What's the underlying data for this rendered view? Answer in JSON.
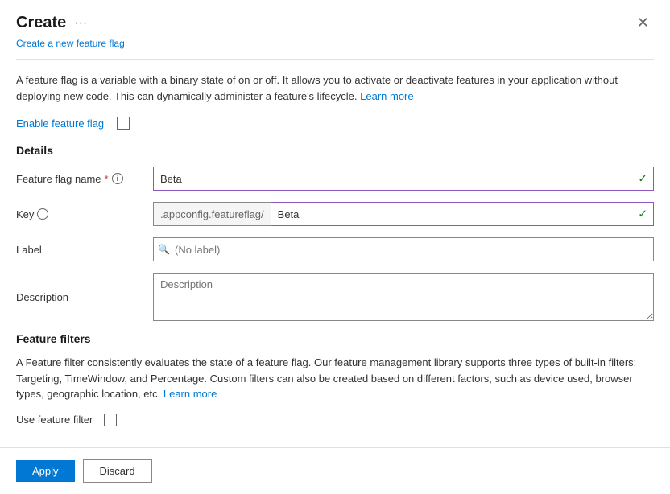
{
  "dialog": {
    "title": "Create",
    "menu_icon": "···",
    "subtitle": "Create a new feature flag",
    "close_label": "✕",
    "description": "A feature flag is a variable with a binary state of on or off. It allows you to activate or deactivate features in your application without deploying new code. This can dynamically administer a feature's lifecycle.",
    "learn_more_link": "Learn more",
    "enable_label": "Enable feature flag",
    "sections": {
      "details": {
        "title": "Details",
        "fields": {
          "feature_flag_name": {
            "label": "Feature flag name",
            "required": true,
            "value": "Beta",
            "info": true
          },
          "key": {
            "label": "Key",
            "prefix": ".appconfig.featureflag/",
            "value": "Beta",
            "info": true
          },
          "label": {
            "label": "Label",
            "placeholder": "(No label)"
          },
          "description": {
            "label": "Description",
            "placeholder": "Description"
          }
        }
      },
      "feature_filters": {
        "title": "Feature filters",
        "description": "A Feature filter consistently evaluates the state of a feature flag. Our feature management library supports three types of built-in filters: Targeting, TimeWindow, and Percentage. Custom filters can also be created based on different factors, such as device used, browser types, geographic location, etc.",
        "learn_more_link": "Learn more",
        "use_filter_label": "Use feature filter"
      }
    },
    "footer": {
      "apply_label": "Apply",
      "discard_label": "Discard"
    }
  }
}
